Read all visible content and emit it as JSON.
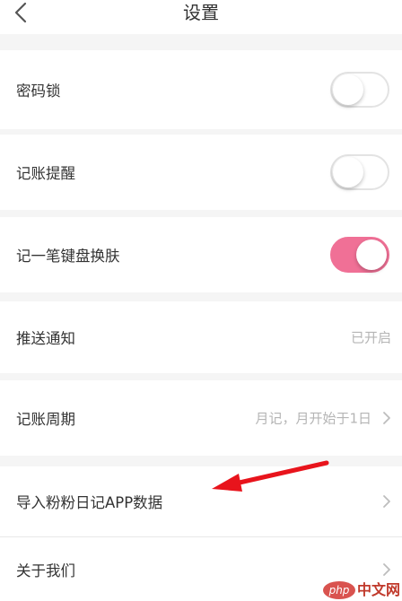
{
  "header": {
    "title": "设置",
    "back_icon": "chevron-left-icon"
  },
  "settings": {
    "password_lock": {
      "label": "密码锁",
      "toggle": "off"
    },
    "bookkeeping_reminder": {
      "label": "记账提醒",
      "toggle": "off"
    },
    "keyboard_skin": {
      "label": "记一笔键盘换肤",
      "toggle": "on"
    },
    "push_notification": {
      "label": "推送通知",
      "value": "已开启"
    },
    "bookkeeping_cycle": {
      "label": "记账周期",
      "value": "月记，月开始于1日",
      "icon": "chevron-right-icon"
    },
    "import_data": {
      "label": "导入粉粉日记APP数据",
      "icon": "chevron-right-icon"
    },
    "about_us": {
      "label": "关于我们",
      "icon": "chevron-right-icon"
    }
  },
  "annotation": {
    "icon": "red-arrow-icon",
    "color": "#e8141c"
  },
  "watermark": {
    "badge": "php",
    "text": "中文网"
  },
  "colors": {
    "accent": "#f07096",
    "background": "#f5f5f5",
    "value_text": "#b5b5b5"
  }
}
